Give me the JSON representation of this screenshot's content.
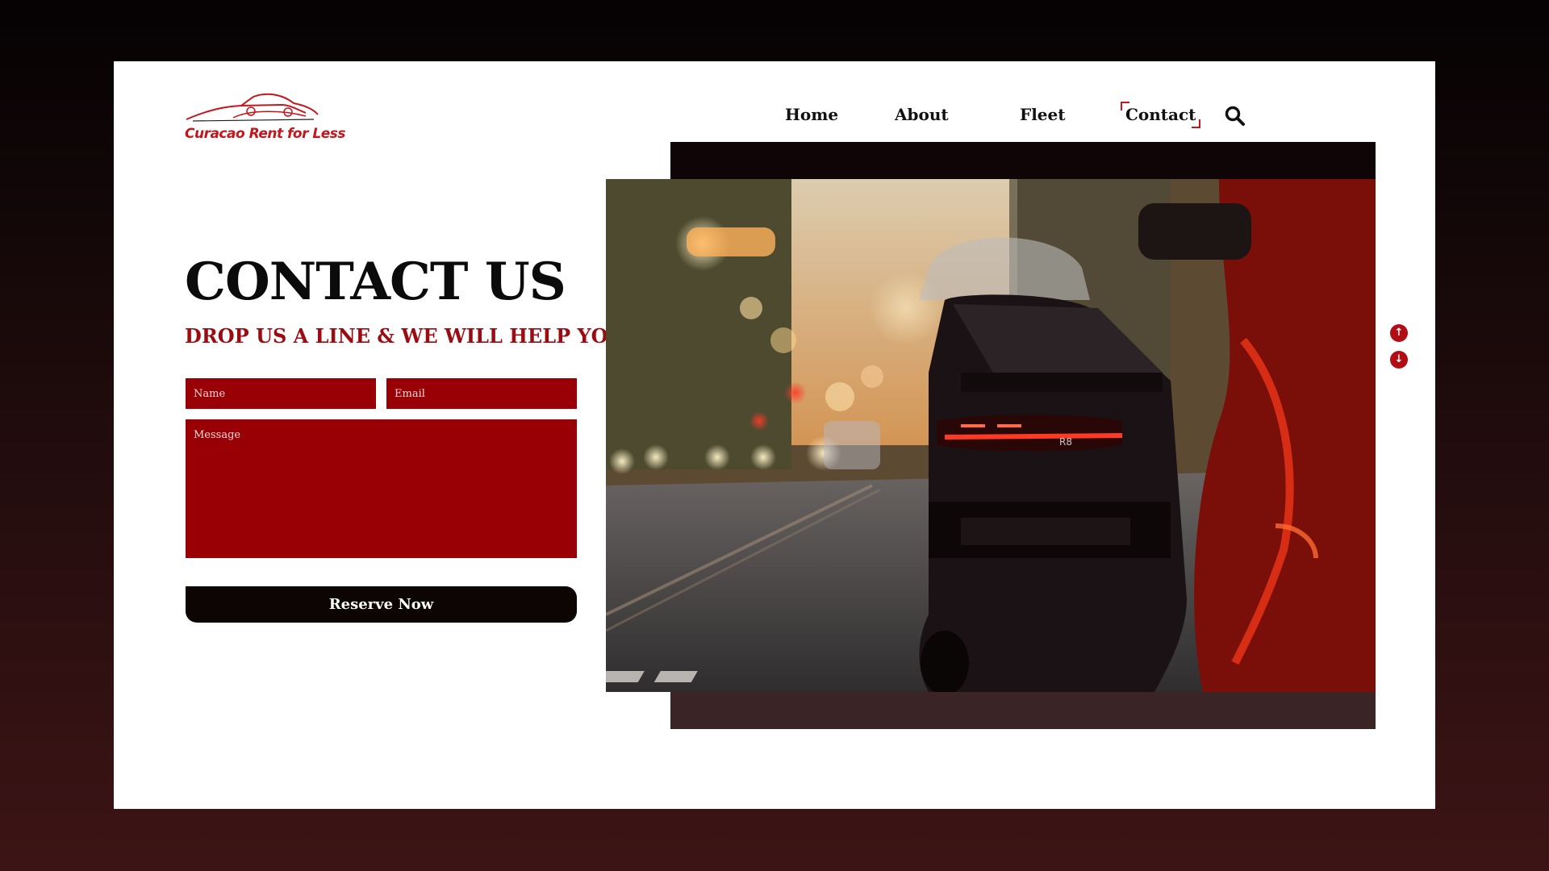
{
  "brand": {
    "name": "Curacao Rent for Less",
    "color": "#c4161c"
  },
  "nav": {
    "items": [
      {
        "label": "Home"
      },
      {
        "label": "About"
      },
      {
        "label": "Fleet"
      },
      {
        "label": "Contact",
        "active": true
      }
    ],
    "search_icon": "search-icon"
  },
  "hero": {
    "title": "CONTACT US",
    "subtitle": "DROP US A LINE & WE WILL HELP YOU."
  },
  "form": {
    "name_placeholder": "Name",
    "email_placeholder": "Email",
    "message_placeholder": "Message",
    "submit_label": "Reserve Now",
    "field_color": "#990006"
  },
  "scroll": {
    "up_icon": "arrow-up-icon",
    "down_icon": "arrow-down-icon"
  },
  "image": {
    "subject": "car-rear-photo",
    "badge_text": "R8"
  }
}
